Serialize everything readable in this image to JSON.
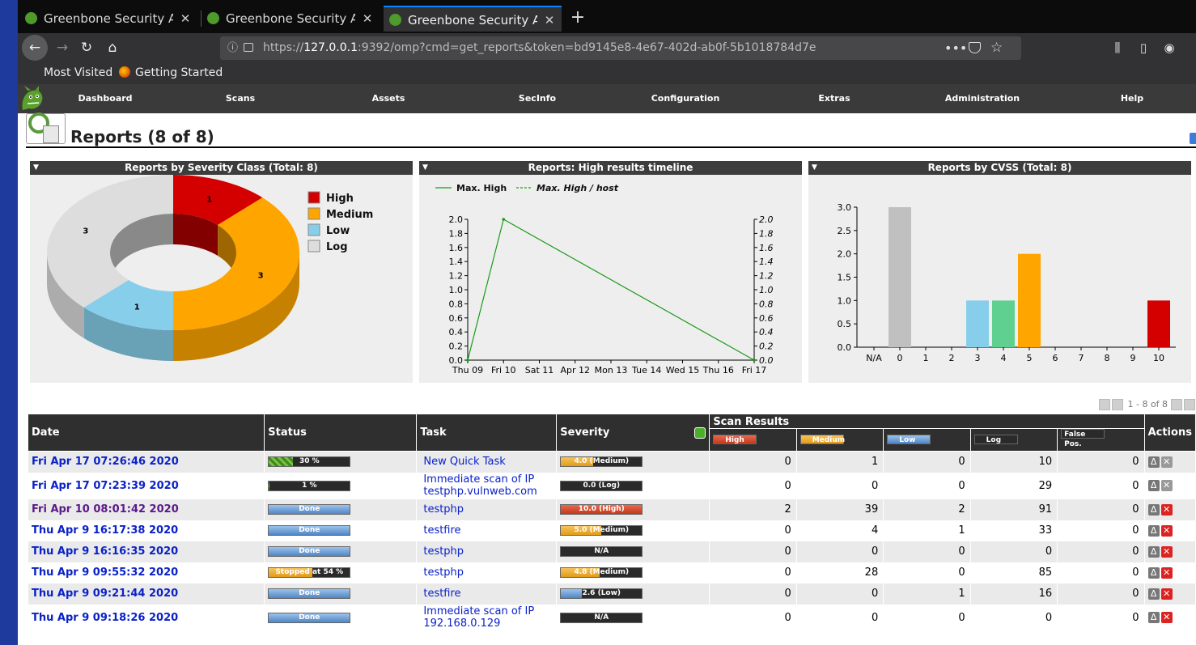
{
  "browser": {
    "tabs": [
      {
        "title": "Greenbone Security Assistant",
        "active": false
      },
      {
        "title": "Greenbone Security Assistant",
        "active": false
      },
      {
        "title": "Greenbone Security Assistant",
        "active": true
      }
    ],
    "url_prefix": "https://",
    "url_host": "127.0.0.1",
    "url_rest": ":9392/omp?cmd=get_reports&token=bd9145e8-4e67-402d-ab0f-5b1018784d7e",
    "bookmarks": [
      "Most Visited",
      "Getting Started"
    ]
  },
  "menu": [
    "Dashboard",
    "Scans",
    "Assets",
    "SecInfo",
    "Configuration",
    "Extras",
    "Administration",
    "Help"
  ],
  "page": {
    "title": "Reports (8 of 8)"
  },
  "panels": {
    "severity": {
      "title": "Reports by Severity Class (Total: 8)"
    },
    "timeline": {
      "title": "Reports: High results timeline"
    },
    "cvss": {
      "title": "Reports by CVSS (Total: 8)"
    }
  },
  "chart_data": [
    {
      "type": "pie",
      "title": "Reports by Severity Class (Total: 8)",
      "categories": [
        "High",
        "Medium",
        "Low",
        "Log"
      ],
      "values": [
        1,
        3,
        1,
        3
      ],
      "colors": [
        "#d40000",
        "#ffa500",
        "#87ceeb",
        "#dddddd"
      ],
      "legend": "right"
    },
    {
      "type": "line",
      "title": "Reports: High results timeline",
      "categories": [
        "Thu 09",
        "Fri 10",
        "Sat 11",
        "Apr 12",
        "Mon 13",
        "Tue 14",
        "Wed 15",
        "Thu 16",
        "Fri 17"
      ],
      "series": [
        {
          "name": "Max. High",
          "x": [
            "Thu 09",
            "Fri 10",
            "Fri 17"
          ],
          "values": [
            0,
            2,
            0
          ]
        },
        {
          "name": "Max. High / host",
          "values": []
        }
      ],
      "ylim": [
        0,
        2.0
      ],
      "yticks": [
        "0.0",
        "0.2",
        "0.4",
        "0.6",
        "0.8",
        "1.0",
        "1.2",
        "1.4",
        "1.6",
        "1.8",
        "2.0"
      ],
      "legend": "top-left"
    },
    {
      "type": "bar",
      "title": "Reports by CVSS (Total: 8)",
      "categories": [
        "N/A",
        "0",
        "1",
        "2",
        "3",
        "4",
        "5",
        "6",
        "7",
        "8",
        "9",
        "10"
      ],
      "values": [
        0,
        3,
        0,
        0,
        1,
        1,
        2,
        0,
        0,
        0,
        0,
        1
      ],
      "colors": [
        "#c0c0c0",
        "#c0c0c0",
        "#87ceeb",
        "#87ceeb",
        "#87ceeb",
        "#60d090",
        "#ffa500",
        "#ffa500",
        "#ffa500",
        "#d40000",
        "#d40000",
        "#d40000"
      ],
      "ylim": [
        0,
        3.0
      ],
      "yticks": [
        "0.0",
        "0.5",
        "1.0",
        "1.5",
        "2.0",
        "2.5",
        "3.0"
      ]
    }
  ],
  "pager": {
    "text": "1 - 8 of 8"
  },
  "table": {
    "headers": {
      "date": "Date",
      "status": "Status",
      "task": "Task",
      "severity": "Severity",
      "scan_results": "Scan Results",
      "actions": "Actions",
      "high": "High",
      "medium": "Medium",
      "low": "Low",
      "log": "Log",
      "false_pos": "False Pos."
    },
    "rows": [
      {
        "date": "Fri Apr 17 07:26:46 2020",
        "status": "30 %",
        "status_pct": 30,
        "status_kind": "prog",
        "task": "New Quick Task",
        "severity": "4.0 (Medium)",
        "sev_value": 4.0,
        "sev_kind": "med",
        "high": "0",
        "medium": "1",
        "low": "0",
        "log": "10",
        "fp": "0",
        "deletable": false,
        "visited": false
      },
      {
        "date": "Fri Apr 17 07:23:39 2020",
        "status": "1 %",
        "status_pct": 1,
        "status_kind": "prog",
        "task": "Immediate scan of IP testphp.vulnweb.com",
        "severity": "0.0 (Log)",
        "sev_value": 0,
        "sev_kind": "log",
        "high": "0",
        "medium": "0",
        "low": "0",
        "log": "29",
        "fp": "0",
        "deletable": false,
        "visited": false
      },
      {
        "date": "Fri Apr 10 08:01:42 2020",
        "status": "Done",
        "status_pct": 100,
        "status_kind": "done",
        "task": "testphp",
        "severity": "10.0 (High)",
        "sev_value": 10.0,
        "sev_kind": "high",
        "high": "2",
        "medium": "39",
        "low": "2",
        "log": "91",
        "fp": "0",
        "deletable": true,
        "visited": true
      },
      {
        "date": "Thu Apr 9 16:17:38 2020",
        "status": "Done",
        "status_pct": 100,
        "status_kind": "done",
        "task": "testfire",
        "severity": "5.0 (Medium)",
        "sev_value": 5.0,
        "sev_kind": "med",
        "high": "0",
        "medium": "4",
        "low": "1",
        "log": "33",
        "fp": "0",
        "deletable": true,
        "visited": false
      },
      {
        "date": "Thu Apr 9 16:16:35 2020",
        "status": "Done",
        "status_pct": 100,
        "status_kind": "done",
        "task": "testphp",
        "severity": "N/A",
        "sev_value": 0,
        "sev_kind": "na",
        "high": "0",
        "medium": "0",
        "low": "0",
        "log": "0",
        "fp": "0",
        "deletable": true,
        "visited": false
      },
      {
        "date": "Thu Apr 9 09:55:32 2020",
        "status": "Stopped at 54 %",
        "status_pct": 54,
        "status_kind": "stopped",
        "task": "testphp",
        "severity": "4.8 (Medium)",
        "sev_value": 4.8,
        "sev_kind": "med",
        "high": "0",
        "medium": "28",
        "low": "0",
        "log": "85",
        "fp": "0",
        "deletable": true,
        "visited": false
      },
      {
        "date": "Thu Apr 9 09:21:44 2020",
        "status": "Done",
        "status_pct": 100,
        "status_kind": "done",
        "task": "testfire",
        "severity": "2.6 (Low)",
        "sev_value": 2.6,
        "sev_kind": "low",
        "high": "0",
        "medium": "0",
        "low": "1",
        "log": "16",
        "fp": "0",
        "deletable": true,
        "visited": false
      },
      {
        "date": "Thu Apr 9 09:18:26 2020",
        "status": "Done",
        "status_pct": 100,
        "status_kind": "done",
        "task": "Immediate scan of IP 192.168.0.129",
        "severity": "N/A",
        "sev_value": 0,
        "sev_kind": "na",
        "high": "0",
        "medium": "0",
        "low": "0",
        "log": "0",
        "fp": "0",
        "deletable": true,
        "visited": false
      }
    ]
  }
}
